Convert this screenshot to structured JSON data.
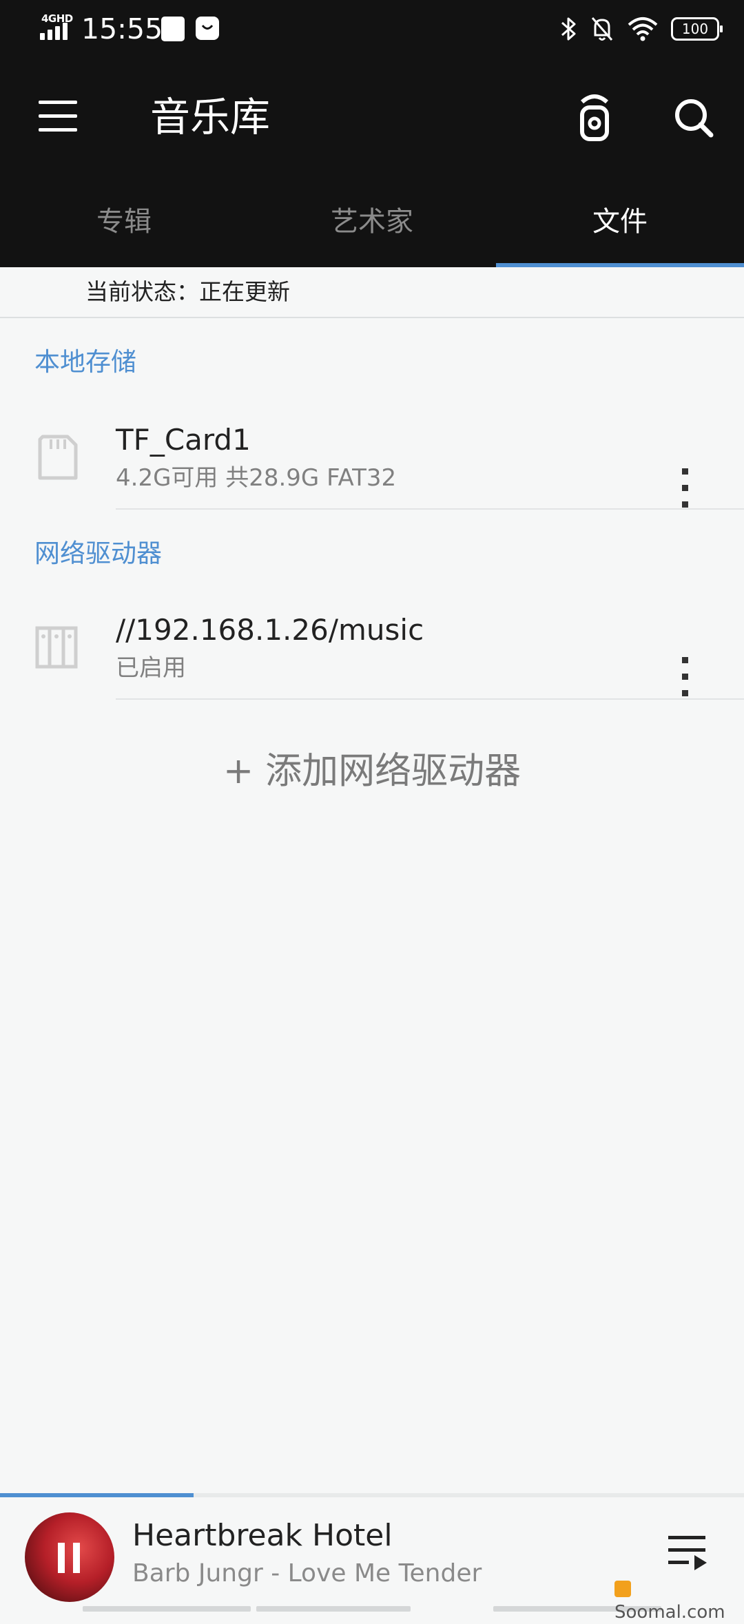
{
  "status_bar": {
    "network": "4GHD",
    "time": "15:55",
    "battery": "100",
    "icons": [
      "bluetooth-icon",
      "bell-off-icon",
      "wifi-icon",
      "battery-icon"
    ]
  },
  "app_bar": {
    "title": "音乐库",
    "icons": [
      "menu-icon",
      "remote-control-icon",
      "search-icon"
    ]
  },
  "tabs": [
    {
      "label": "专辑",
      "active": false
    },
    {
      "label": "艺术家",
      "active": false
    },
    {
      "label": "文件",
      "active": true
    }
  ],
  "status_line": "当前状态：正在更新",
  "local_storage": {
    "header": "本地存储",
    "items": [
      {
        "title": "TF_Card1",
        "subtitle": "4.2G可用 共28.9G  FAT32",
        "icon": "sd-card-icon"
      }
    ]
  },
  "network_drives": {
    "header": "网络驱动器",
    "items": [
      {
        "title": "//192.168.1.26/music",
        "subtitle": "已启用",
        "icon": "nas-drive-icon"
      }
    ],
    "add_label": "+ 添加网络驱动器"
  },
  "now_playing": {
    "title": "Heartbreak Hotel",
    "subtitle": "Barb Jungr - Love Me Tender",
    "progress": 0.26,
    "state": "playing"
  },
  "watermark": "Soomal.com",
  "colors": {
    "accent": "#4f8fd1",
    "app_bar": "#121212",
    "background": "#f6f7f7"
  }
}
